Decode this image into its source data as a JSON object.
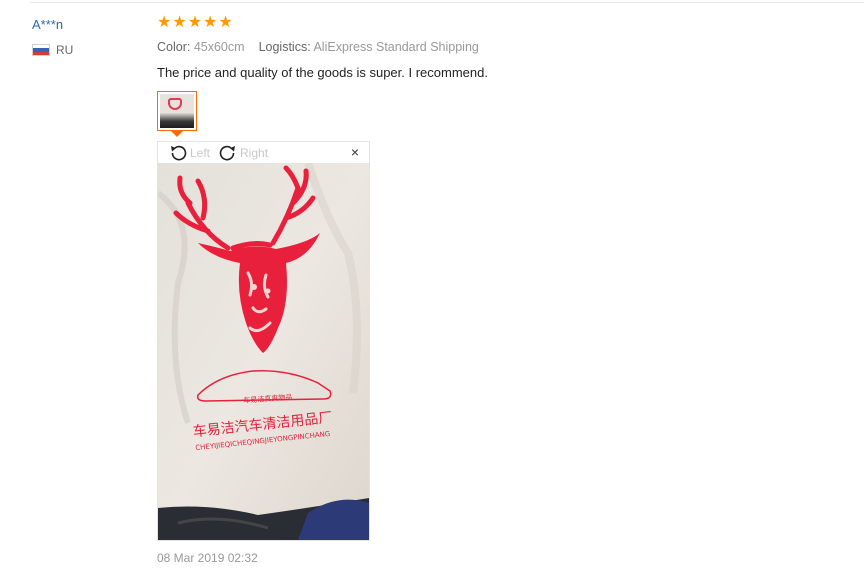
{
  "review": {
    "user_name": "A***n",
    "country": "RU",
    "rating": 5,
    "star_glyph": "★",
    "color_label": "Color:",
    "color_value": "45x60cm",
    "logistics_label": "Logistics:",
    "logistics_value": "AliExpress Standard Shipping",
    "text": "The price and quality of the goods is super. I recommend.",
    "date": "08 Mar 2019 02:32"
  },
  "viewer": {
    "rotate_left_label": "Left",
    "rotate_right_label": "Right",
    "close_glyph": "×"
  },
  "photo": {
    "brand_small": "车易洁真爽物品",
    "brand_chinese": "车易洁汽车清洁用品厂",
    "brand_pinyin": "CHEYIJIEQICHEQINGJIEYONGPINCHANG"
  },
  "colors": {
    "link": "#2a6bb0",
    "star": "#ff9900",
    "accent": "#ff6a00",
    "print_red": "#e8203c"
  },
  "icons": {
    "flag": "flag-ru-icon",
    "rotate_left": "rotate-left-icon",
    "rotate_right": "rotate-right-icon",
    "close": "close-icon"
  }
}
